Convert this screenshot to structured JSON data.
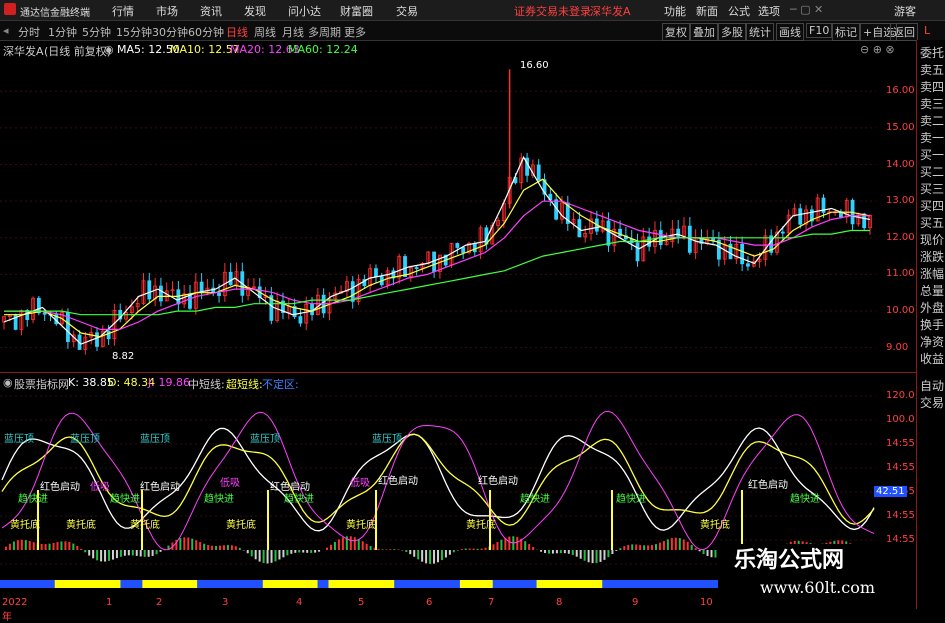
{
  "app": {
    "title": "通达信金融终端"
  },
  "menu": {
    "items": [
      "行情",
      "市场",
      "资讯",
      "发现",
      "问小达",
      "财富圈",
      "交易"
    ]
  },
  "notice": "证券交易未登录",
  "stock_name": "深华发A",
  "top_right": [
    "功能",
    "新面",
    "公式",
    "选项",
    "游客"
  ],
  "periods": [
    "分时",
    "1分钟",
    "5分钟",
    "15分钟",
    "30分钟",
    "60分钟",
    "日线",
    "周线",
    "月线",
    "多周期",
    "更多"
  ],
  "active_period": "日线",
  "toolbar_right": [
    "复权",
    "叠加",
    "多股",
    "统计",
    "画线",
    "F10",
    "标记",
    "+自选",
    "返回"
  ],
  "main_header": {
    "name": "深华发A",
    "mode": "(日线 前复权)",
    "ma5": "MA5: 12.50",
    "ma10": "MA10: 12.57",
    "ma20": "MA20: 12.63",
    "ma60": "MA60: 12.24"
  },
  "indicator_header": {
    "name": "股票指标网",
    "k": "K: 38.85",
    "d": "D: 48.34",
    "j": "J: 19.86",
    "l1": "中短线:",
    "l2": "超短线:",
    "l3": "不定区:"
  },
  "price_axis": [
    "16.00",
    "15.00",
    "14.00",
    "13.00",
    "12.00",
    "11.00",
    "10.00",
    "9.00"
  ],
  "ind_axis": [
    "120.0",
    "100.0",
    "14:55",
    "14:55",
    "14:55",
    "14:55",
    "14:55",
    "14:55"
  ],
  "ind_current": "42.51",
  "annotations": {
    "high": "16.60",
    "low": "8.82"
  },
  "right_panel": [
    "委托",
    "卖五",
    "卖四",
    "卖三",
    "卖二",
    "卖一",
    "买一",
    "买二",
    "买三",
    "买四",
    "买五",
    "现价",
    "涨跌",
    "涨幅",
    "总量",
    "外盘",
    "换手",
    "净资",
    "收益",
    "自动",
    "交易"
  ],
  "right_side_mark": "L",
  "x_labels": [
    "2022年",
    "1",
    "2",
    "3",
    "4",
    "5",
    "6",
    "7",
    "8",
    "9",
    "10"
  ],
  "signals": [
    "蓝压顶",
    "红色启动",
    "黄托底",
    "趋快进",
    "低吸",
    "涨跌"
  ],
  "watermark": {
    "cn": "乐淘公式网",
    "url": "www.60lt.com"
  },
  "colors": {
    "up": "#ff3030",
    "down": "#30d0ff",
    "ma5": "#ffffff",
    "ma10": "#ffff40",
    "ma20": "#ff40ff",
    "ma60": "#40ff40"
  },
  "chart_data": {
    "type": "line",
    "title": "深华发A (日线 前复权)",
    "ylim": [
      8.5,
      16.8
    ],
    "series": [
      {
        "name": "MA5",
        "values": [
          9.7,
          9.9,
          10.1,
          9.6,
          9.1,
          9.3,
          9.8,
          10.4,
          10.6,
          10.3,
          10.5,
          10.6,
          10.9,
          10.5,
          10.1,
          9.9,
          10.0,
          10.4,
          10.6,
          10.9,
          11.0,
          11.2,
          11.3,
          11.5,
          11.8,
          11.9,
          13.0,
          14.2,
          13.3,
          12.6,
          12.2,
          12.3,
          12.0,
          11.7,
          12.0,
          12.1,
          11.9,
          11.8,
          11.5,
          11.3,
          12.0,
          12.6,
          12.7,
          12.8,
          12.6,
          12.5
        ]
      },
      {
        "name": "MA10",
        "values": [
          9.9,
          9.9,
          10.0,
          9.8,
          9.4,
          9.3,
          9.5,
          10.0,
          10.4,
          10.4,
          10.5,
          10.5,
          10.7,
          10.6,
          10.3,
          10.1,
          10.0,
          10.2,
          10.4,
          10.7,
          10.9,
          11.0,
          11.2,
          11.4,
          11.6,
          11.8,
          12.4,
          13.3,
          13.6,
          13.0,
          12.6,
          12.3,
          12.1,
          11.9,
          11.9,
          12.0,
          12.0,
          11.9,
          11.7,
          11.5,
          11.7,
          12.2,
          12.5,
          12.7,
          12.7,
          12.6
        ]
      },
      {
        "name": "MA20",
        "values": [
          10.0,
          10.0,
          10.0,
          9.9,
          9.7,
          9.5,
          9.5,
          9.7,
          10.0,
          10.2,
          10.4,
          10.5,
          10.6,
          10.6,
          10.5,
          10.3,
          10.2,
          10.2,
          10.3,
          10.5,
          10.7,
          10.9,
          11.0,
          11.2,
          11.4,
          11.6,
          12.0,
          12.6,
          13.0,
          13.0,
          12.8,
          12.6,
          12.4,
          12.2,
          12.1,
          12.0,
          12.0,
          12.0,
          11.9,
          11.8,
          11.8,
          12.0,
          12.3,
          12.5,
          12.6,
          12.6
        ]
      },
      {
        "name": "MA60",
        "values": [
          10.0,
          10.0,
          10.0,
          10.0,
          9.9,
          9.9,
          9.9,
          9.9,
          9.9,
          10.0,
          10.0,
          10.1,
          10.1,
          10.2,
          10.2,
          10.2,
          10.3,
          10.3,
          10.3,
          10.4,
          10.5,
          10.6,
          10.7,
          10.8,
          10.9,
          11.0,
          11.1,
          11.3,
          11.5,
          11.6,
          11.7,
          11.8,
          11.9,
          11.9,
          12.0,
          12.0,
          12.0,
          12.0,
          12.0,
          12.0,
          12.0,
          12.0,
          12.1,
          12.1,
          12.2,
          12.2
        ]
      }
    ]
  }
}
